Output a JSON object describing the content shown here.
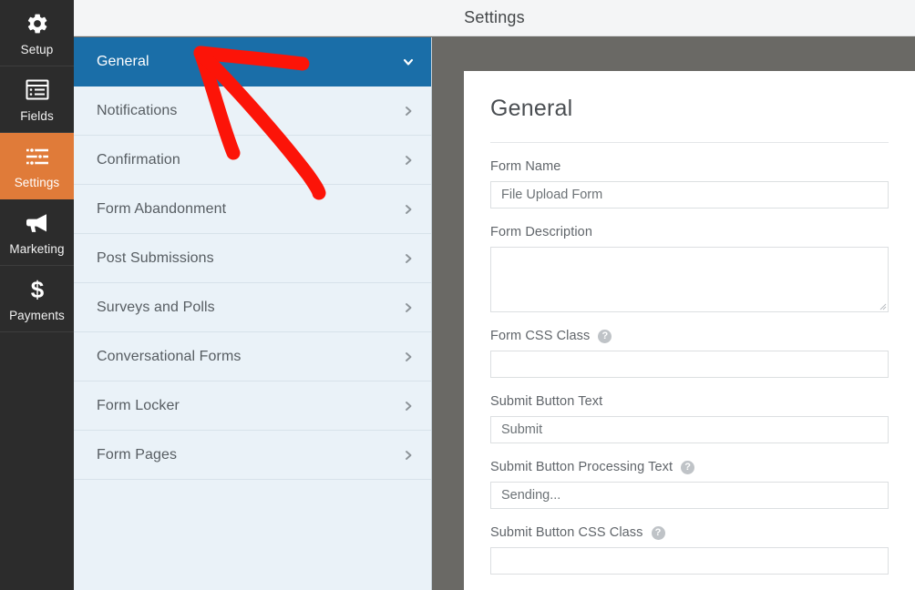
{
  "header": {
    "title": "Settings"
  },
  "rail": {
    "items": [
      {
        "label": "Setup",
        "icon": "gear-icon",
        "active": false
      },
      {
        "label": "Fields",
        "icon": "fields-icon",
        "active": false
      },
      {
        "label": "Settings",
        "icon": "sliders-icon",
        "active": true
      },
      {
        "label": "Marketing",
        "icon": "megaphone-icon",
        "active": false
      },
      {
        "label": "Payments",
        "icon": "dollar-icon",
        "active": false
      }
    ],
    "active_color": "#e07b39",
    "background_color": "#2c2c2c"
  },
  "settings_nav": {
    "active_color": "#1a6ea8",
    "items": [
      {
        "label": "General",
        "chevron": "chevron-down-icon",
        "active": true
      },
      {
        "label": "Notifications",
        "chevron": "chevron-right-icon",
        "active": false
      },
      {
        "label": "Confirmation",
        "chevron": "chevron-right-icon",
        "active": false
      },
      {
        "label": "Form Abandonment",
        "chevron": "chevron-right-icon",
        "active": false
      },
      {
        "label": "Post Submissions",
        "chevron": "chevron-right-icon",
        "active": false
      },
      {
        "label": "Surveys and Polls",
        "chevron": "chevron-right-icon",
        "active": false
      },
      {
        "label": "Conversational Forms",
        "chevron": "chevron-right-icon",
        "active": false
      },
      {
        "label": "Form Locker",
        "chevron": "chevron-right-icon",
        "active": false
      },
      {
        "label": "Form Pages",
        "chevron": "chevron-right-icon",
        "active": false
      }
    ]
  },
  "content": {
    "title": "General",
    "fields": [
      {
        "label": "Form Name",
        "type": "text",
        "value": "File Upload Form",
        "placeholder": "",
        "help": false
      },
      {
        "label": "Form Description",
        "type": "textarea",
        "value": "",
        "placeholder": "",
        "help": false
      },
      {
        "label": "Form CSS Class",
        "type": "text",
        "value": "",
        "placeholder": "",
        "help": true,
        "help_icon": "help-circle-icon"
      },
      {
        "label": "Submit Button Text",
        "type": "text",
        "value": "Submit",
        "placeholder": "",
        "help": false
      },
      {
        "label": "Submit Button Processing Text",
        "type": "text",
        "value": "Sending...",
        "placeholder": "",
        "help": true,
        "help_icon": "help-circle-icon"
      },
      {
        "label": "Submit Button CSS Class",
        "type": "text",
        "value": "",
        "placeholder": "",
        "help": true,
        "help_icon": "help-circle-icon"
      }
    ]
  },
  "annotation": {
    "type": "hand-drawn-arrow",
    "color": "#fc1408",
    "points_to": "General"
  }
}
